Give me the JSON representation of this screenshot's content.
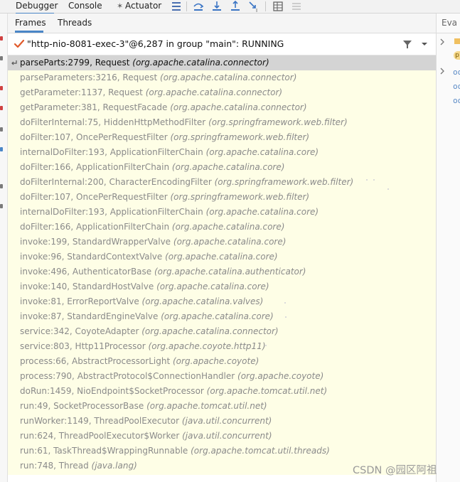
{
  "toolbar": {
    "tabs": [
      "Debugger",
      "Console",
      "Actuator"
    ],
    "active_tab": "Debugger"
  },
  "subtabs": {
    "frames_label": "Frames",
    "threads_label": "Threads"
  },
  "thread": {
    "text": "\"http-nio-8081-exec-3\"@6,287 in group \"main\": RUNNING"
  },
  "frames": [
    {
      "name": "parseParts:2799, Request",
      "pkg": "(org.apache.catalina.connector)"
    },
    {
      "name": "parseParameters:3216, Request",
      "pkg": "(org.apache.catalina.connector)"
    },
    {
      "name": "getParameter:1137, Request",
      "pkg": "(org.apache.catalina.connector)"
    },
    {
      "name": "getParameter:381, RequestFacade",
      "pkg": "(org.apache.catalina.connector)"
    },
    {
      "name": "doFilterInternal:75, HiddenHttpMethodFilter",
      "pkg": "(org.springframework.web.filter)"
    },
    {
      "name": "doFilter:107, OncePerRequestFilter",
      "pkg": "(org.springframework.web.filter)"
    },
    {
      "name": "internalDoFilter:193, ApplicationFilterChain",
      "pkg": "(org.apache.catalina.core)"
    },
    {
      "name": "doFilter:166, ApplicationFilterChain",
      "pkg": "(org.apache.catalina.core)"
    },
    {
      "name": "doFilterInternal:200, CharacterEncodingFilter",
      "pkg": "(org.springframework.web.filter)"
    },
    {
      "name": "doFilter:107, OncePerRequestFilter",
      "pkg": "(org.springframework.web.filter)"
    },
    {
      "name": "internalDoFilter:193, ApplicationFilterChain",
      "pkg": "(org.apache.catalina.core)"
    },
    {
      "name": "doFilter:166, ApplicationFilterChain",
      "pkg": "(org.apache.catalina.core)"
    },
    {
      "name": "invoke:199, StandardWrapperValve",
      "pkg": "(org.apache.catalina.core)"
    },
    {
      "name": "invoke:96, StandardContextValve",
      "pkg": "(org.apache.catalina.core)"
    },
    {
      "name": "invoke:496, AuthenticatorBase",
      "pkg": "(org.apache.catalina.authenticator)"
    },
    {
      "name": "invoke:140, StandardHostValve",
      "pkg": "(org.apache.catalina.core)"
    },
    {
      "name": "invoke:81, ErrorReportValve",
      "pkg": "(org.apache.catalina.valves)"
    },
    {
      "name": "invoke:87, StandardEngineValve",
      "pkg": "(org.apache.catalina.core)"
    },
    {
      "name": "service:342, CoyoteAdapter",
      "pkg": "(org.apache.catalina.connector)"
    },
    {
      "name": "service:803, Http11Processor",
      "pkg": "(org.apache.coyote.http11)"
    },
    {
      "name": "process:66, AbstractProcessorLight",
      "pkg": "(org.apache.coyote)"
    },
    {
      "name": "process:790, AbstractProtocol$ConnectionHandler",
      "pkg": "(org.apache.coyote)"
    },
    {
      "name": "doRun:1459, NioEndpoint$SocketProcessor",
      "pkg": "(org.apache.tomcat.util.net)"
    },
    {
      "name": "run:49, SocketProcessorBase",
      "pkg": "(org.apache.tomcat.util.net)"
    },
    {
      "name": "runWorker:1149, ThreadPoolExecutor",
      "pkg": "(java.util.concurrent)"
    },
    {
      "name": "run:624, ThreadPoolExecutor$Worker",
      "pkg": "(java.util.concurrent)"
    },
    {
      "name": "run:61, TaskThread$WrappingRunnable",
      "pkg": "(org.apache.tomcat.util.threads)"
    },
    {
      "name": "run:748, Thread",
      "pkg": "(java.lang)"
    }
  ],
  "right_panel": {
    "label": "Eva"
  },
  "watermark": "CSDN @园区阿祖",
  "colors": {
    "frames_bg": "#fefee6",
    "selected_bg": "#d4d4d4",
    "accent": "#4a86c7",
    "check": "#e05a2b"
  }
}
